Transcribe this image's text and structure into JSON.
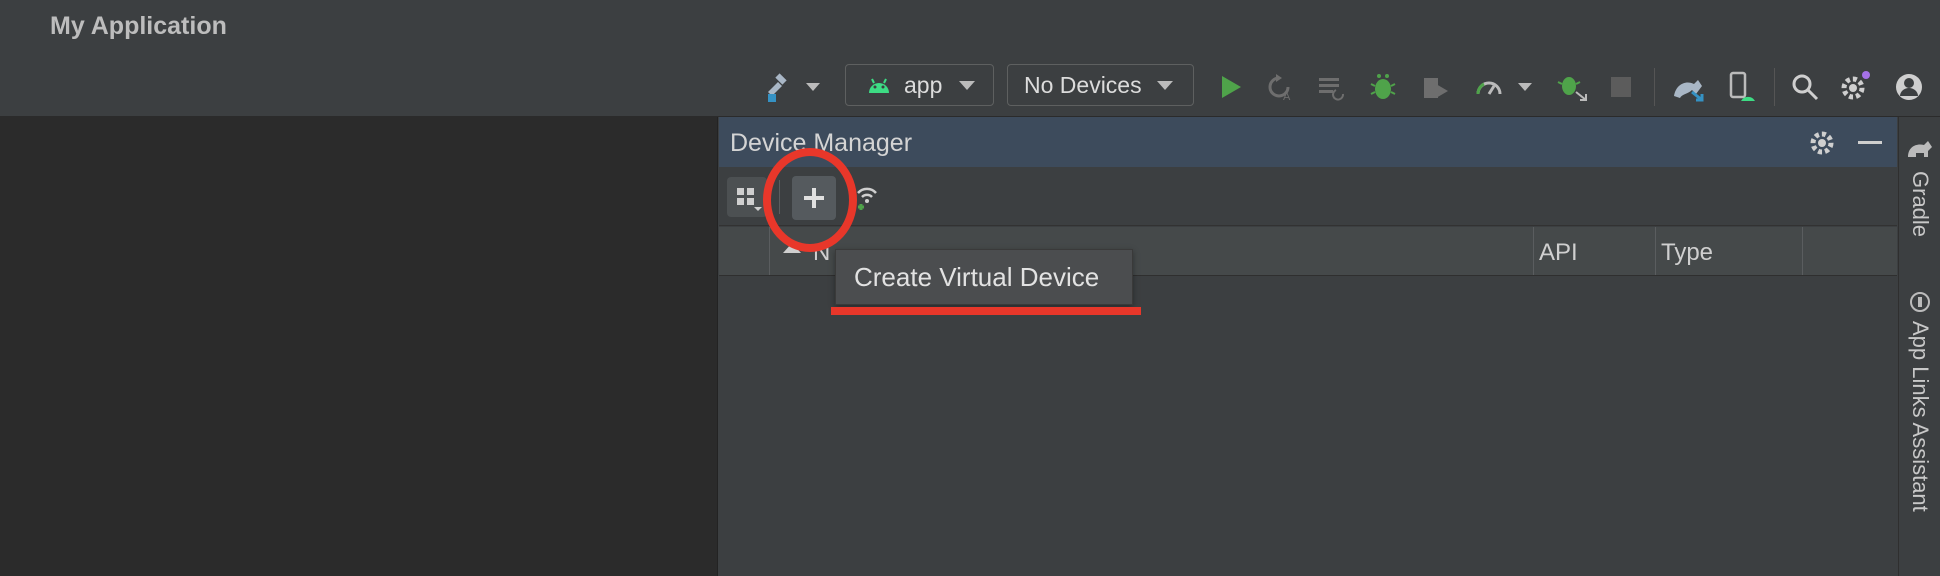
{
  "window": {
    "title": "My Application"
  },
  "toolbar": {
    "module_combo": "app",
    "device_combo": "No Devices",
    "icons": [
      "hammer-icon",
      "run-icon",
      "apply-changes-icon",
      "apply-code-changes-icon",
      "debug-icon",
      "attach-debugger-icon",
      "profile-icon",
      "attach-process-icon",
      "stop-icon",
      "sync-gradle-icon",
      "device-manager-icon",
      "search-icon",
      "settings-icon",
      "account-icon"
    ]
  },
  "panel": {
    "title": "Device Manager",
    "tooltip": "Create Virtual Device",
    "columns": {
      "name_partial": "N",
      "api": "API",
      "type": "Type"
    }
  },
  "right_strip": {
    "gradle": "Gradle",
    "app_links": "App Links Assistant"
  },
  "colors": {
    "accent_run": "#4fa34a",
    "annotation_red": "#e8372a",
    "panel_header": "#3d4b5c"
  }
}
